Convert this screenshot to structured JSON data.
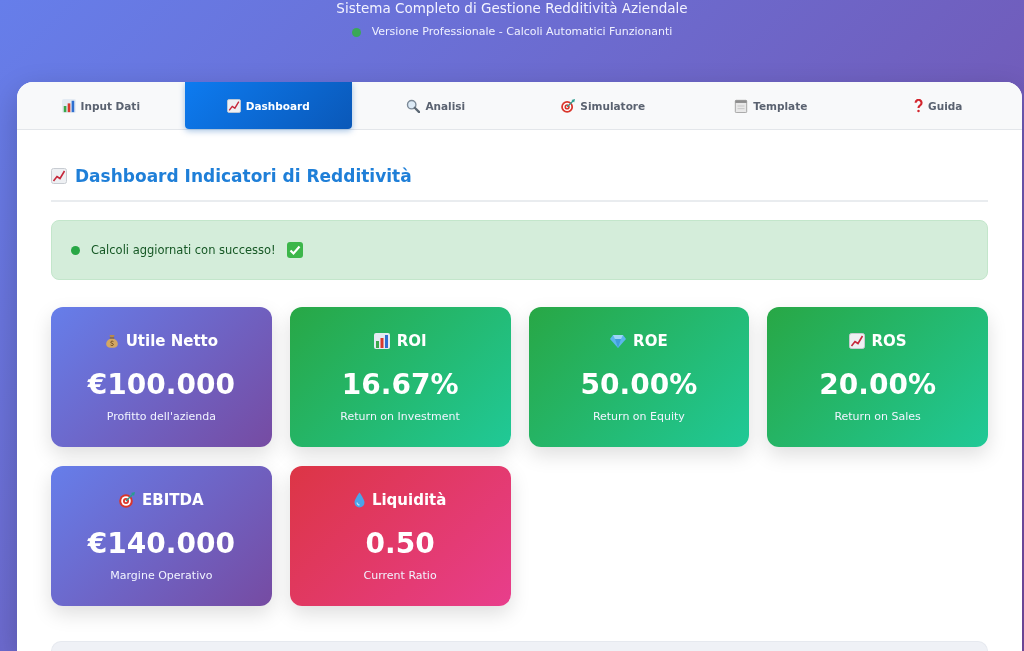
{
  "header": {
    "title": "Sistema Completo di Gestione Redditività Aziendale",
    "subtitle": "Versione Professionale - Calcoli Automatici Funzionanti"
  },
  "tabs": [
    {
      "label": "Input Dati",
      "selected": false
    },
    {
      "label": "Dashboard",
      "selected": true
    },
    {
      "label": "Analisi",
      "selected": false
    },
    {
      "label": "Simulatore",
      "selected": false
    },
    {
      "label": "Template",
      "selected": false
    },
    {
      "label": "Guida",
      "selected": false
    }
  ],
  "dashboard": {
    "heading": "Dashboard Indicatori di Redditività",
    "alert": "Calcoli aggiornati con successo!",
    "cards": [
      {
        "kind": "primary",
        "title": "Utile Netto",
        "value": "€100.000",
        "caption": "Profitto dell'azienda"
      },
      {
        "kind": "success",
        "title": "ROI",
        "value": "16.67%",
        "caption": "Return on Investment"
      },
      {
        "kind": "success",
        "title": "ROE",
        "value": "50.00%",
        "caption": "Return on Equity"
      },
      {
        "kind": "success",
        "title": "ROS",
        "value": "20.00%",
        "caption": "Return on Sales"
      },
      {
        "kind": "primary",
        "title": "EBITDA",
        "value": "€140.000",
        "caption": "Margine Operativo"
      },
      {
        "kind": "danger",
        "title": "Liquidità",
        "value": "0.50",
        "caption": "Current Ratio"
      }
    ]
  }
}
